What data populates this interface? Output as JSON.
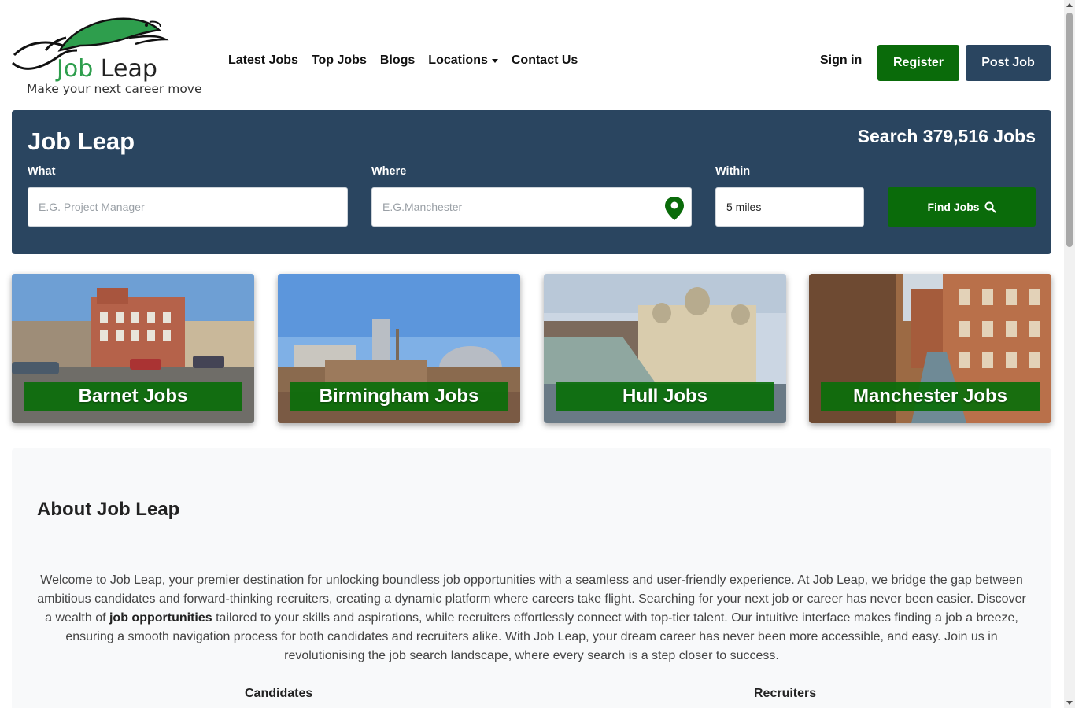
{
  "brand": {
    "logo_word_1": "Job",
    "logo_word_2": "Leap",
    "tagline": "Make your next career move"
  },
  "nav": {
    "items": [
      {
        "label": "Latest Jobs"
      },
      {
        "label": "Top Jobs"
      },
      {
        "label": "Blogs"
      },
      {
        "label": "Locations",
        "dropdown": true
      },
      {
        "label": "Contact Us"
      }
    ],
    "sign_in": "Sign in",
    "register": "Register",
    "post_job": "Post Job"
  },
  "search": {
    "title": "Job Leap",
    "count_text": "Search 379,516 Jobs",
    "what_label": "What",
    "what_placeholder": "E.G. Project Manager",
    "where_label": "Where",
    "where_placeholder": "E.G.Manchester",
    "within_label": "Within",
    "within_value": "5 miles",
    "find_button": "Find Jobs"
  },
  "cities": [
    {
      "label": "Barnet Jobs"
    },
    {
      "label": "Birmingham Jobs"
    },
    {
      "label": "Hull Jobs"
    },
    {
      "label": "Manchester Jobs"
    }
  ],
  "about": {
    "title": "About Job Leap",
    "text_part_1": "Welcome to Job Leap, your premier destination for unlocking boundless job opportunities with a seamless and user-friendly experience. At Job Leap, we bridge the gap between ambitious candidates and forward-thinking recruiters, creating a dynamic platform where careers take flight. Searching for your next job or career has never been easier. Discover a wealth of ",
    "text_bold": "job opportunities",
    "text_part_2": " tailored to your skills and aspirations, while recruiters effortlessly connect with top-tier talent. Our intuitive interface makes finding a job a breeze, ensuring a smooth navigation process for both candidates and recruiters alike. With Job Leap, your dream career has never been more accessible, and easy. Join us in revolutionising the job search landscape, where every search is a step closer to success.",
    "candidates_heading": "Candidates",
    "recruiters_heading": "Recruiters"
  },
  "colors": {
    "brand_green": "#0a6b0a",
    "navy": "#2a4560",
    "logo_green": "#2e9e4d"
  }
}
